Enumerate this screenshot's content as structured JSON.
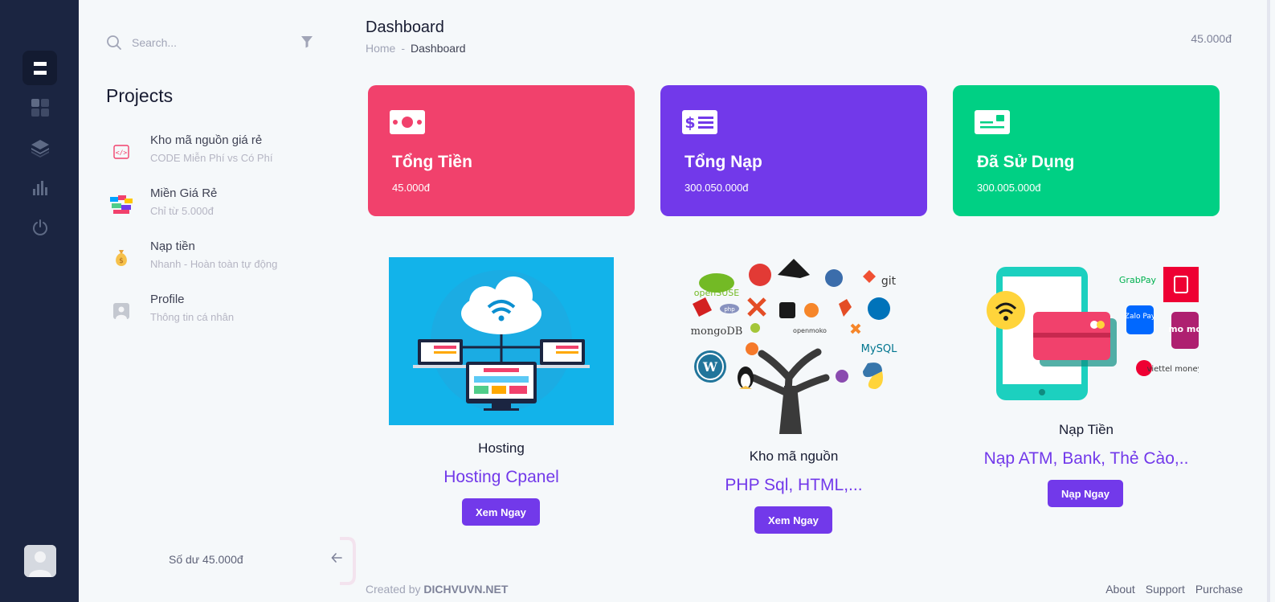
{
  "search": {
    "placeholder": "Search..."
  },
  "sidebar": {
    "title": "Projects",
    "items": [
      {
        "title": "Kho mã nguồn giá rẻ",
        "subtitle": "CODE Miễn Phí vs Có Phí",
        "icon": "code-icon"
      },
      {
        "title": "Miền Giá Rẻ",
        "subtitle": "Chỉ từ 5.000đ",
        "icon": "domain-icon"
      },
      {
        "title": "Nạp tiền",
        "subtitle": "Nhanh - Hoàn toàn tự động",
        "icon": "money-bag-icon"
      },
      {
        "title": "Profile",
        "subtitle": "Thông tin cá nhân",
        "icon": "user-icon"
      }
    ],
    "balance": "Số dư 45.000đ"
  },
  "header": {
    "title": "Dashboard",
    "breadcrumb_home": "Home",
    "breadcrumb_sep": "-",
    "breadcrumb_current": "Dashboard",
    "balance": "45.000đ"
  },
  "stats": [
    {
      "title": "Tổng Tiền",
      "value": "45.000đ",
      "color": "#f1416c"
    },
    {
      "title": "Tổng Nạp",
      "value": "300.050.000đ",
      "color": "#7239ea"
    },
    {
      "title": "Đã Sử Dụng",
      "value": "300.005.000đ",
      "color": "#00d084"
    }
  ],
  "products": [
    {
      "category": "Hosting",
      "name": "Hosting Cpanel",
      "button": "Xem Ngay"
    },
    {
      "category": "Kho mã nguồn",
      "name": "PHP Sql, HTML,...",
      "button": "Xem Ngay"
    },
    {
      "category": "Nạp Tiền",
      "name": "Nạp ATM, Bank, Thẻ Cào,..",
      "button": "Nạp Ngay"
    }
  ],
  "logos": {
    "opensuse": "openSUSE",
    "git": "git",
    "php": "php",
    "mongodb": "mongoDB",
    "openmoko": "openmoko",
    "mysql": "MySQL",
    "grabpay": "GrabPay",
    "zalopay": "Zalo Pay",
    "momo": "mo mo",
    "viettel": "viettel money"
  },
  "footer": {
    "created_by": "Created by",
    "brand": "DICHVUVN.NET",
    "links": [
      "About",
      "Support",
      "Purchase"
    ]
  },
  "colors": {
    "rail": "#1b2541",
    "accent": "#7239ea"
  }
}
